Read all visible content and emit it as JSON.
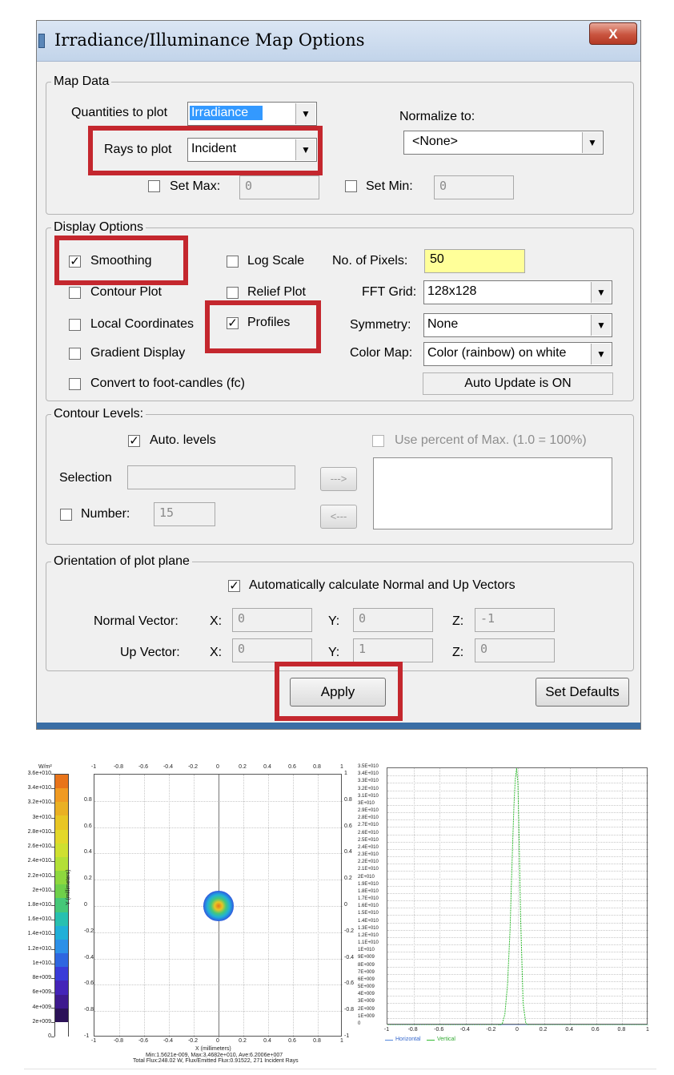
{
  "dialog": {
    "title": "Irradiance/Illuminance Map Options",
    "close_label": "X"
  },
  "map_data": {
    "legend": "Map Data",
    "quantities_label": "Quantities to plot",
    "quantities_value": "Irradiance",
    "rays_label": "Rays to plot",
    "rays_value": "Incident",
    "normalize_label": "Normalize to:",
    "normalize_value": "<None>",
    "set_max_label": "Set Max:",
    "set_max_value": "0",
    "set_min_label": "Set Min:",
    "set_min_value": "0"
  },
  "display": {
    "legend": "Display Options",
    "smoothing": "Smoothing",
    "log_scale": "Log Scale",
    "contour_plot": "Contour Plot",
    "relief_plot": "Relief Plot",
    "local_coords": "Local Coordinates",
    "profiles": "Profiles",
    "gradient": "Gradient Display",
    "foot_candles": "Convert to foot-candles (fc)",
    "pixels_label": "No. of Pixels:",
    "pixels_value": "50",
    "fft_label": "FFT Grid:",
    "fft_value": "128x128",
    "symmetry_label": "Symmetry:",
    "symmetry_value": "None",
    "colormap_label": "Color Map:",
    "colormap_value": "Color (rainbow) on white",
    "auto_update": "Auto Update is ON"
  },
  "contour": {
    "legend": "Contour Levels:",
    "auto_levels": "Auto. levels",
    "use_percent": "Use percent of Max. (1.0 = 100%)",
    "selection_label": "Selection",
    "add_label": "--->",
    "remove_label": "<---",
    "number_label": "Number:",
    "number_value": "15"
  },
  "orientation": {
    "legend": "Orientation of plot plane",
    "auto_calc": "Automatically calculate Normal and Up Vectors",
    "normal_label": "Normal Vector:",
    "up_label": "Up Vector:",
    "x_label": "X:",
    "y_label": "Y:",
    "z_label": "Z:",
    "normal_x": "0",
    "normal_y": "0",
    "normal_z": "-1",
    "up_x": "0",
    "up_y": "1",
    "up_z": "0"
  },
  "buttons": {
    "apply": "Apply",
    "set_defaults": "Set Defaults"
  },
  "colors": {
    "highlight": "#c4272e",
    "selection": "#3399ff",
    "pixels_field": "#ffff99",
    "profile_curve": "#33bb33"
  },
  "chart_data": [
    {
      "type": "heatmap",
      "title": "",
      "unit_label": "W/m²",
      "colorbar_ticks": [
        "3.6e+010",
        "3.4e+010",
        "3.2e+010",
        "3e+010",
        "2.8e+010",
        "2.6e+010",
        "2.4e+010",
        "2.2e+010",
        "2e+010",
        "1.8e+010",
        "1.6e+010",
        "1.4e+010",
        "1.2e+010",
        "1e+010",
        "8e+009",
        "6e+009",
        "4e+009",
        "2e+009",
        "0"
      ],
      "colorbar_colors": [
        "#e8741a",
        "#f09a22",
        "#eab023",
        "#e8c624",
        "#e3d82a",
        "#cfe030",
        "#b3e036",
        "#8ed83e",
        "#6fd04a",
        "#46c878",
        "#28c0b0",
        "#20b0d8",
        "#2c90e8",
        "#2e66e0",
        "#3a3cd8",
        "#4424b8",
        "#3e1a8e",
        "#2c1258",
        "#ffffff"
      ],
      "x_ticks": [
        "-1",
        "-0.8",
        "-0.6",
        "-0.4",
        "-0.2",
        "0",
        "0.2",
        "0.4",
        "0.6",
        "0.8",
        "1"
      ],
      "y_ticks_right": [
        "1",
        "0.8",
        "0.6",
        "0.4",
        "0.2",
        "0",
        "-0.2",
        "-0.4",
        "-0.6",
        "-0.8",
        "-1"
      ],
      "y_ticks_left": [
        "0.8",
        "0.6",
        "0.4",
        "0.2",
        "0",
        "-0.2",
        "-0.4",
        "-0.6",
        "-0.8",
        "-1"
      ],
      "xlabel": "X (millimeters)",
      "ylabel": "Y (millimeters)",
      "xlim": [
        -1,
        1
      ],
      "ylim": [
        -1,
        1
      ],
      "spot_center": [
        0,
        0
      ],
      "spot_radius": 0.04,
      "stats_line1": "Min:1.5621e-009, Max:3.4682e+010, Ave:6.2006e+007",
      "stats_line2": "Total Flux:248.02 W, Flux/Emitted Flux:0.91522, 271 Incident Rays"
    },
    {
      "type": "line",
      "title": "",
      "y_ticks": [
        "3.5E+010",
        "3.4E+010",
        "3.3E+010",
        "3.2E+010",
        "3.1E+010",
        "3E+010",
        "2.9E+010",
        "2.8E+010",
        "2.7E+010",
        "2.6E+010",
        "2.5E+010",
        "2.4E+010",
        "2.3E+010",
        "2.2E+010",
        "2.1E+010",
        "2E+010",
        "1.9E+010",
        "1.8E+010",
        "1.7E+010",
        "1.6E+010",
        "1.5E+010",
        "1.4E+010",
        "1.3E+010",
        "1.2E+010",
        "1.1E+010",
        "1E+010",
        "9E+009",
        "8E+009",
        "7E+009",
        "6E+009",
        "5E+009",
        "4E+009",
        "3E+009",
        "2E+009",
        "1E+009",
        "0"
      ],
      "x_ticks": [
        "-1",
        "-0.8",
        "-0.6",
        "-0.4",
        "-0.2",
        "0",
        "0.2",
        "0.4",
        "0.6",
        "0.8",
        "1"
      ],
      "xlim": [
        -1,
        1
      ],
      "ylim": [
        0,
        35000000000.0
      ],
      "series": [
        {
          "name": "Horizontal",
          "color": "#5588dd",
          "x": [
            -1,
            1
          ],
          "y": [
            0,
            0
          ]
        },
        {
          "name": "Vertical",
          "color": "#33bb33",
          "x": [
            -1,
            -0.2,
            -0.15,
            -0.12,
            -0.1,
            -0.08,
            -0.06,
            -0.05,
            -0.04,
            -0.03,
            -0.02,
            -0.01,
            0.0,
            0.01,
            0.02,
            0.04,
            0.06,
            0.08,
            1
          ],
          "y": [
            0,
            0,
            0,
            200000000.0,
            1500000000.0,
            5500000000.0,
            13000000000.0,
            19000000000.0,
            25000000000.0,
            30000000000.0,
            33500000000.0,
            35000000000.0,
            33000000000.0,
            25000000000.0,
            15000000000.0,
            3000000000.0,
            300000000.0,
            0,
            0
          ]
        }
      ]
    }
  ]
}
